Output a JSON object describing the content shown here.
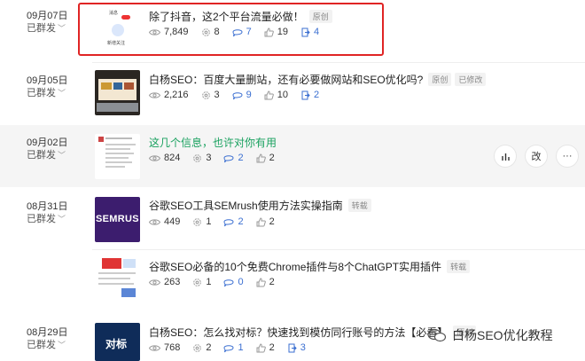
{
  "articles": [
    {
      "date": "09月07日",
      "status": "已群发",
      "thumb_text_top": "消息",
      "thumb_text_bottom": "新增关注",
      "title": "除了抖音，这2个平台流量必做！",
      "tags": [
        "原创"
      ],
      "views": "7,849",
      "shares": "8",
      "comments": "7",
      "likes": "19",
      "reposts": "4"
    },
    {
      "date": "09月05日",
      "status": "已群发",
      "title": "白杨SEO：百度大量删站，还有必要做网站和SEO优化吗?",
      "tags": [
        "原创",
        "已修改"
      ],
      "views": "2,216",
      "shares": "3",
      "comments": "9",
      "likes": "10",
      "reposts": "2"
    },
    {
      "date": "09月02日",
      "status": "已群发",
      "title": "这几个信息，也许对你有用",
      "tags": [],
      "views": "824",
      "shares": "3",
      "comments": "2",
      "likes": "2"
    },
    {
      "date": "08月31日",
      "status": "已群发",
      "thumb_text": "SEMRUS",
      "title": "谷歌SEO工具SEMrush使用方法实操指南",
      "tags": [
        "转载"
      ],
      "views": "449",
      "shares": "1",
      "comments": "2",
      "likes": "2"
    },
    {
      "title": "谷歌SEO必备的10个免费Chrome插件与8个ChatGPT实用插件",
      "tags": [
        "转载"
      ],
      "views": "263",
      "shares": "1",
      "comments": "0",
      "likes": "2"
    },
    {
      "date": "08月29日",
      "status": "已群发",
      "thumb_text": "对标",
      "title": "白杨SEO：怎么找对标？快速找到模仿同行账号的方法【必看】",
      "tags": [
        "原创"
      ],
      "views": "768",
      "shares": "2",
      "comments": "1",
      "likes": "2",
      "reposts": "3"
    }
  ],
  "actions": {
    "stats_icon": "bar-chart-icon",
    "edit_label": "改",
    "more_label": "···"
  },
  "watermark": {
    "text": "白杨SEO优化教程"
  },
  "colors": {
    "accent_blue": "#3b6fd1",
    "green_title": "#19a15f",
    "highlight_border": "#e02424"
  }
}
